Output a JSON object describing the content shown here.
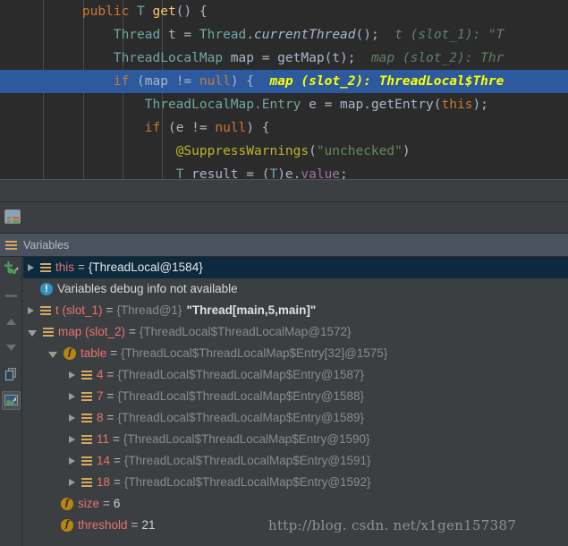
{
  "editor": {
    "lines": [
      {
        "indent": 4,
        "tokens": [
          {
            "t": "public",
            "c": "k"
          },
          {
            "t": " ",
            "c": "p"
          },
          {
            "t": "T",
            "c": "t"
          },
          {
            "t": " ",
            "c": "p"
          },
          {
            "t": "get",
            "c": "m"
          },
          {
            "t": "() {",
            "c": "p"
          }
        ],
        "hint": "",
        "selected": false
      },
      {
        "indent": 8,
        "tokens": [
          {
            "t": "Thread",
            "c": "t"
          },
          {
            "t": " t = ",
            "c": "p"
          },
          {
            "t": "Thread",
            "c": "t"
          },
          {
            "t": ".",
            "c": "p"
          },
          {
            "t": "currentThread",
            "c": "mi"
          },
          {
            "t": "();",
            "c": "p"
          }
        ],
        "hint": "  t (slot_1): \"T",
        "selected": false
      },
      {
        "indent": 8,
        "tokens": [
          {
            "t": "ThreadLocalMap",
            "c": "t"
          },
          {
            "t": " map = ",
            "c": "p"
          },
          {
            "t": "getMap",
            "c": "p"
          },
          {
            "t": "(t);",
            "c": "p"
          }
        ],
        "hint": "  map (slot_2): Thr",
        "selected": false
      },
      {
        "indent": 8,
        "tokens": [
          {
            "t": "if",
            "c": "k"
          },
          {
            "t": " (map != ",
            "c": "p"
          },
          {
            "t": "null",
            "c": "k"
          },
          {
            "t": ") {",
            "c": "p"
          }
        ],
        "hint": "  map (slot_2): ThreadLocal$Thre",
        "selected": true
      },
      {
        "indent": 12,
        "tokens": [
          {
            "t": "ThreadLocalMap.Entry",
            "c": "t"
          },
          {
            "t": " e = map.",
            "c": "p"
          },
          {
            "t": "getEntry",
            "c": "p"
          },
          {
            "t": "(",
            "c": "p"
          },
          {
            "t": "this",
            "c": "k"
          },
          {
            "t": ");",
            "c": "p"
          }
        ],
        "hint": "",
        "selected": false
      },
      {
        "indent": 12,
        "tokens": [
          {
            "t": "if",
            "c": "k"
          },
          {
            "t": " (e != ",
            "c": "p"
          },
          {
            "t": "null",
            "c": "k"
          },
          {
            "t": ") {",
            "c": "p"
          }
        ],
        "hint": "",
        "selected": false
      },
      {
        "indent": 16,
        "tokens": [
          {
            "t": "@SuppressWarnings",
            "c": "an"
          },
          {
            "t": "(",
            "c": "p"
          },
          {
            "t": "\"unchecked\"",
            "c": "s"
          },
          {
            "t": ")",
            "c": "p"
          }
        ],
        "hint": "",
        "selected": false
      },
      {
        "indent": 16,
        "tokens": [
          {
            "t": "T",
            "c": "t"
          },
          {
            "t": " result = (",
            "c": "p"
          },
          {
            "t": "T",
            "c": "t"
          },
          {
            "t": ")e.",
            "c": "p"
          },
          {
            "t": "value",
            "c": "f"
          },
          {
            "t": ";",
            "c": "p"
          }
        ],
        "hint": "",
        "selected": false
      }
    ]
  },
  "toolstrip": {
    "calculator_icon": "calculator-icon"
  },
  "variables_panel": {
    "tab_label": "Variables",
    "sidebar_buttons": [
      {
        "name": "add-watch-icon",
        "label": "+"
      },
      {
        "name": "remove-watch-icon",
        "label": "–"
      },
      {
        "name": "move-up-icon",
        "label": "▲"
      },
      {
        "name": "move-down-icon",
        "label": "▼"
      },
      {
        "name": "copy-icon",
        "label": "copy"
      },
      {
        "name": "inspect-icon",
        "label": "inspect"
      }
    ],
    "rows": [
      {
        "indent": 0,
        "arrow": "closed",
        "icon": "var",
        "name": "this",
        "eq": "=",
        "ref": "{ThreadLocal@1584}",
        "str": "",
        "selected": true
      },
      {
        "indent": 0,
        "arrow": "none",
        "icon": "info",
        "name": "",
        "eq": "",
        "ref": "",
        "plain": "Variables debug info not available",
        "str": "",
        "selected": false
      },
      {
        "indent": 0,
        "arrow": "closed",
        "icon": "var",
        "name": "t (slot_1)",
        "eq": "=",
        "ref": "{Thread@1}",
        "str": "\"Thread[main,5,main]\"",
        "selected": false
      },
      {
        "indent": 0,
        "arrow": "open",
        "icon": "var",
        "name": "map (slot_2)",
        "eq": "=",
        "ref": "{ThreadLocal$ThreadLocalMap@1572}",
        "str": "",
        "selected": false
      },
      {
        "indent": 1,
        "arrow": "open",
        "icon": "field",
        "name": "table",
        "eq": "=",
        "ref": "{ThreadLocal$ThreadLocalMap$Entry[32]@1575}",
        "str": "",
        "selected": false
      },
      {
        "indent": 2,
        "arrow": "closed",
        "icon": "var",
        "name": "4",
        "eq": "=",
        "ref": "{ThreadLocal$ThreadLocalMap$Entry@1587}",
        "str": "",
        "selected": false
      },
      {
        "indent": 2,
        "arrow": "closed",
        "icon": "var",
        "name": "7",
        "eq": "=",
        "ref": "{ThreadLocal$ThreadLocalMap$Entry@1588}",
        "str": "",
        "selected": false
      },
      {
        "indent": 2,
        "arrow": "closed",
        "icon": "var",
        "name": "8",
        "eq": "=",
        "ref": "{ThreadLocal$ThreadLocalMap$Entry@1589}",
        "str": "",
        "selected": false
      },
      {
        "indent": 2,
        "arrow": "closed",
        "icon": "var",
        "name": "11",
        "eq": "=",
        "ref": "{ThreadLocal$ThreadLocalMap$Entry@1590}",
        "str": "",
        "selected": false
      },
      {
        "indent": 2,
        "arrow": "closed",
        "icon": "var",
        "name": "14",
        "eq": "=",
        "ref": "{ThreadLocal$ThreadLocalMap$Entry@1591}",
        "str": "",
        "selected": false
      },
      {
        "indent": 2,
        "arrow": "closed",
        "icon": "var",
        "name": "18",
        "eq": "=",
        "ref": "{ThreadLocal$ThreadLocalMap$Entry@1592}",
        "str": "",
        "selected": false
      },
      {
        "indent": 1,
        "arrow": "none",
        "icon": "field",
        "name": "size",
        "eq": "=",
        "ref": "",
        "num": "6",
        "str": "",
        "selected": false
      },
      {
        "indent": 1,
        "arrow": "none",
        "icon": "field",
        "name": "threshold",
        "eq": "=",
        "ref": "",
        "num": "21",
        "str": "",
        "selected": false
      }
    ]
  },
  "watermark": {
    "text": "http://blog. csdn. net/x1gen157387"
  },
  "colors": {
    "editor_bg": "#2b2b2b",
    "panel_bg": "#3c3f41",
    "tab_bg": "#4a5260",
    "current_line": "#2d5a9e",
    "selection": "#0d293e",
    "keyword": "#cc7832",
    "type": "#6fa8a0",
    "method": "#ffc66d",
    "string": "#6a8759",
    "annotation": "#bbb529",
    "field": "#9876aa",
    "hint": "#5f826b",
    "hint_selected": "#ffff00",
    "var_name": "#e8726d",
    "var_ref": "#8a8a8a"
  }
}
